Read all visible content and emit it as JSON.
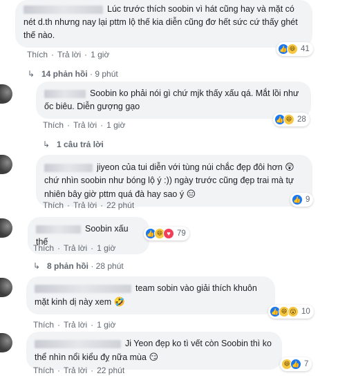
{
  "comments": [
    {
      "text": "Lúc trước thích soobin vì hát cũng hay và mặt có nét d.th nhưng nay lại pttm lộ thế kia diễn cũng đơ hết sức cứ thấy ghét thế nào.",
      "like_label": "Thích",
      "reply_label": "Trả lời",
      "time": "1 giờ",
      "reactions": [
        "like",
        "haha"
      ],
      "reaction_count": "41",
      "replies_text": "14 phản hồi",
      "replies_time": "9 phút"
    },
    {
      "text": "Soobin ko phải nói gì chứ mjk thấy xấu qá. Mắt lồi như ốc biêu. Diễn gượng gạo",
      "name_fragment": "Chen Siro",
      "like_label": "Thích",
      "reply_label": "Trả lời",
      "time": "1 giờ",
      "reactions": [
        "like",
        "haha"
      ],
      "reaction_count": "28",
      "replies_text": "1 câu trả lời"
    },
    {
      "text": "jiyeon của tui diễn với tùng núi chắc đẹp đôi hơn",
      "text2": "chứ nhìn soobin như bóng lộ ý :)) ngày trước cũng đẹp trai mà tự nhiên bây giờ pttm quá đà hay sao ý",
      "emoji1": "😲",
      "emoji2": "😑",
      "like_label": "Thích",
      "reply_label": "Trả lời",
      "time": "22 phút",
      "reactions": [
        "like"
      ],
      "reaction_count": "9"
    },
    {
      "text": "Soobin xấu thế",
      "like_label": "Thích",
      "reply_label": "Trả lời",
      "time": "1 giờ",
      "reactions": [
        "like",
        "haha",
        "love"
      ],
      "reaction_count": "79",
      "replies_text": "8 phản hồi",
      "replies_time": "28 phút"
    },
    {
      "text": "team sobin vào giải thích khuôn mặt kinh dị này xem",
      "emoji1": "🤣",
      "like_label": "Thích",
      "reply_label": "Trả lời",
      "time": "1 giờ",
      "reactions": [
        "like",
        "haha",
        "wow"
      ],
      "reaction_count": "10"
    },
    {
      "text": "Ji Yeon đẹp ko tì vết còn Soobin thì ko thể nhìn nổi kiểu đỵ nữa mùa",
      "emoji1": "😏",
      "like_label": "Thích",
      "reply_label": "Trả lời",
      "time": "22 phút",
      "reactions": [
        "haha",
        "like"
      ],
      "reaction_count": "7"
    }
  ],
  "icons": {
    "like": "thumbs-up-icon",
    "haha": "laughing-face-icon",
    "love": "heart-icon",
    "wow": "surprised-face-icon",
    "reply_arrow": "reply-arrow-icon"
  }
}
